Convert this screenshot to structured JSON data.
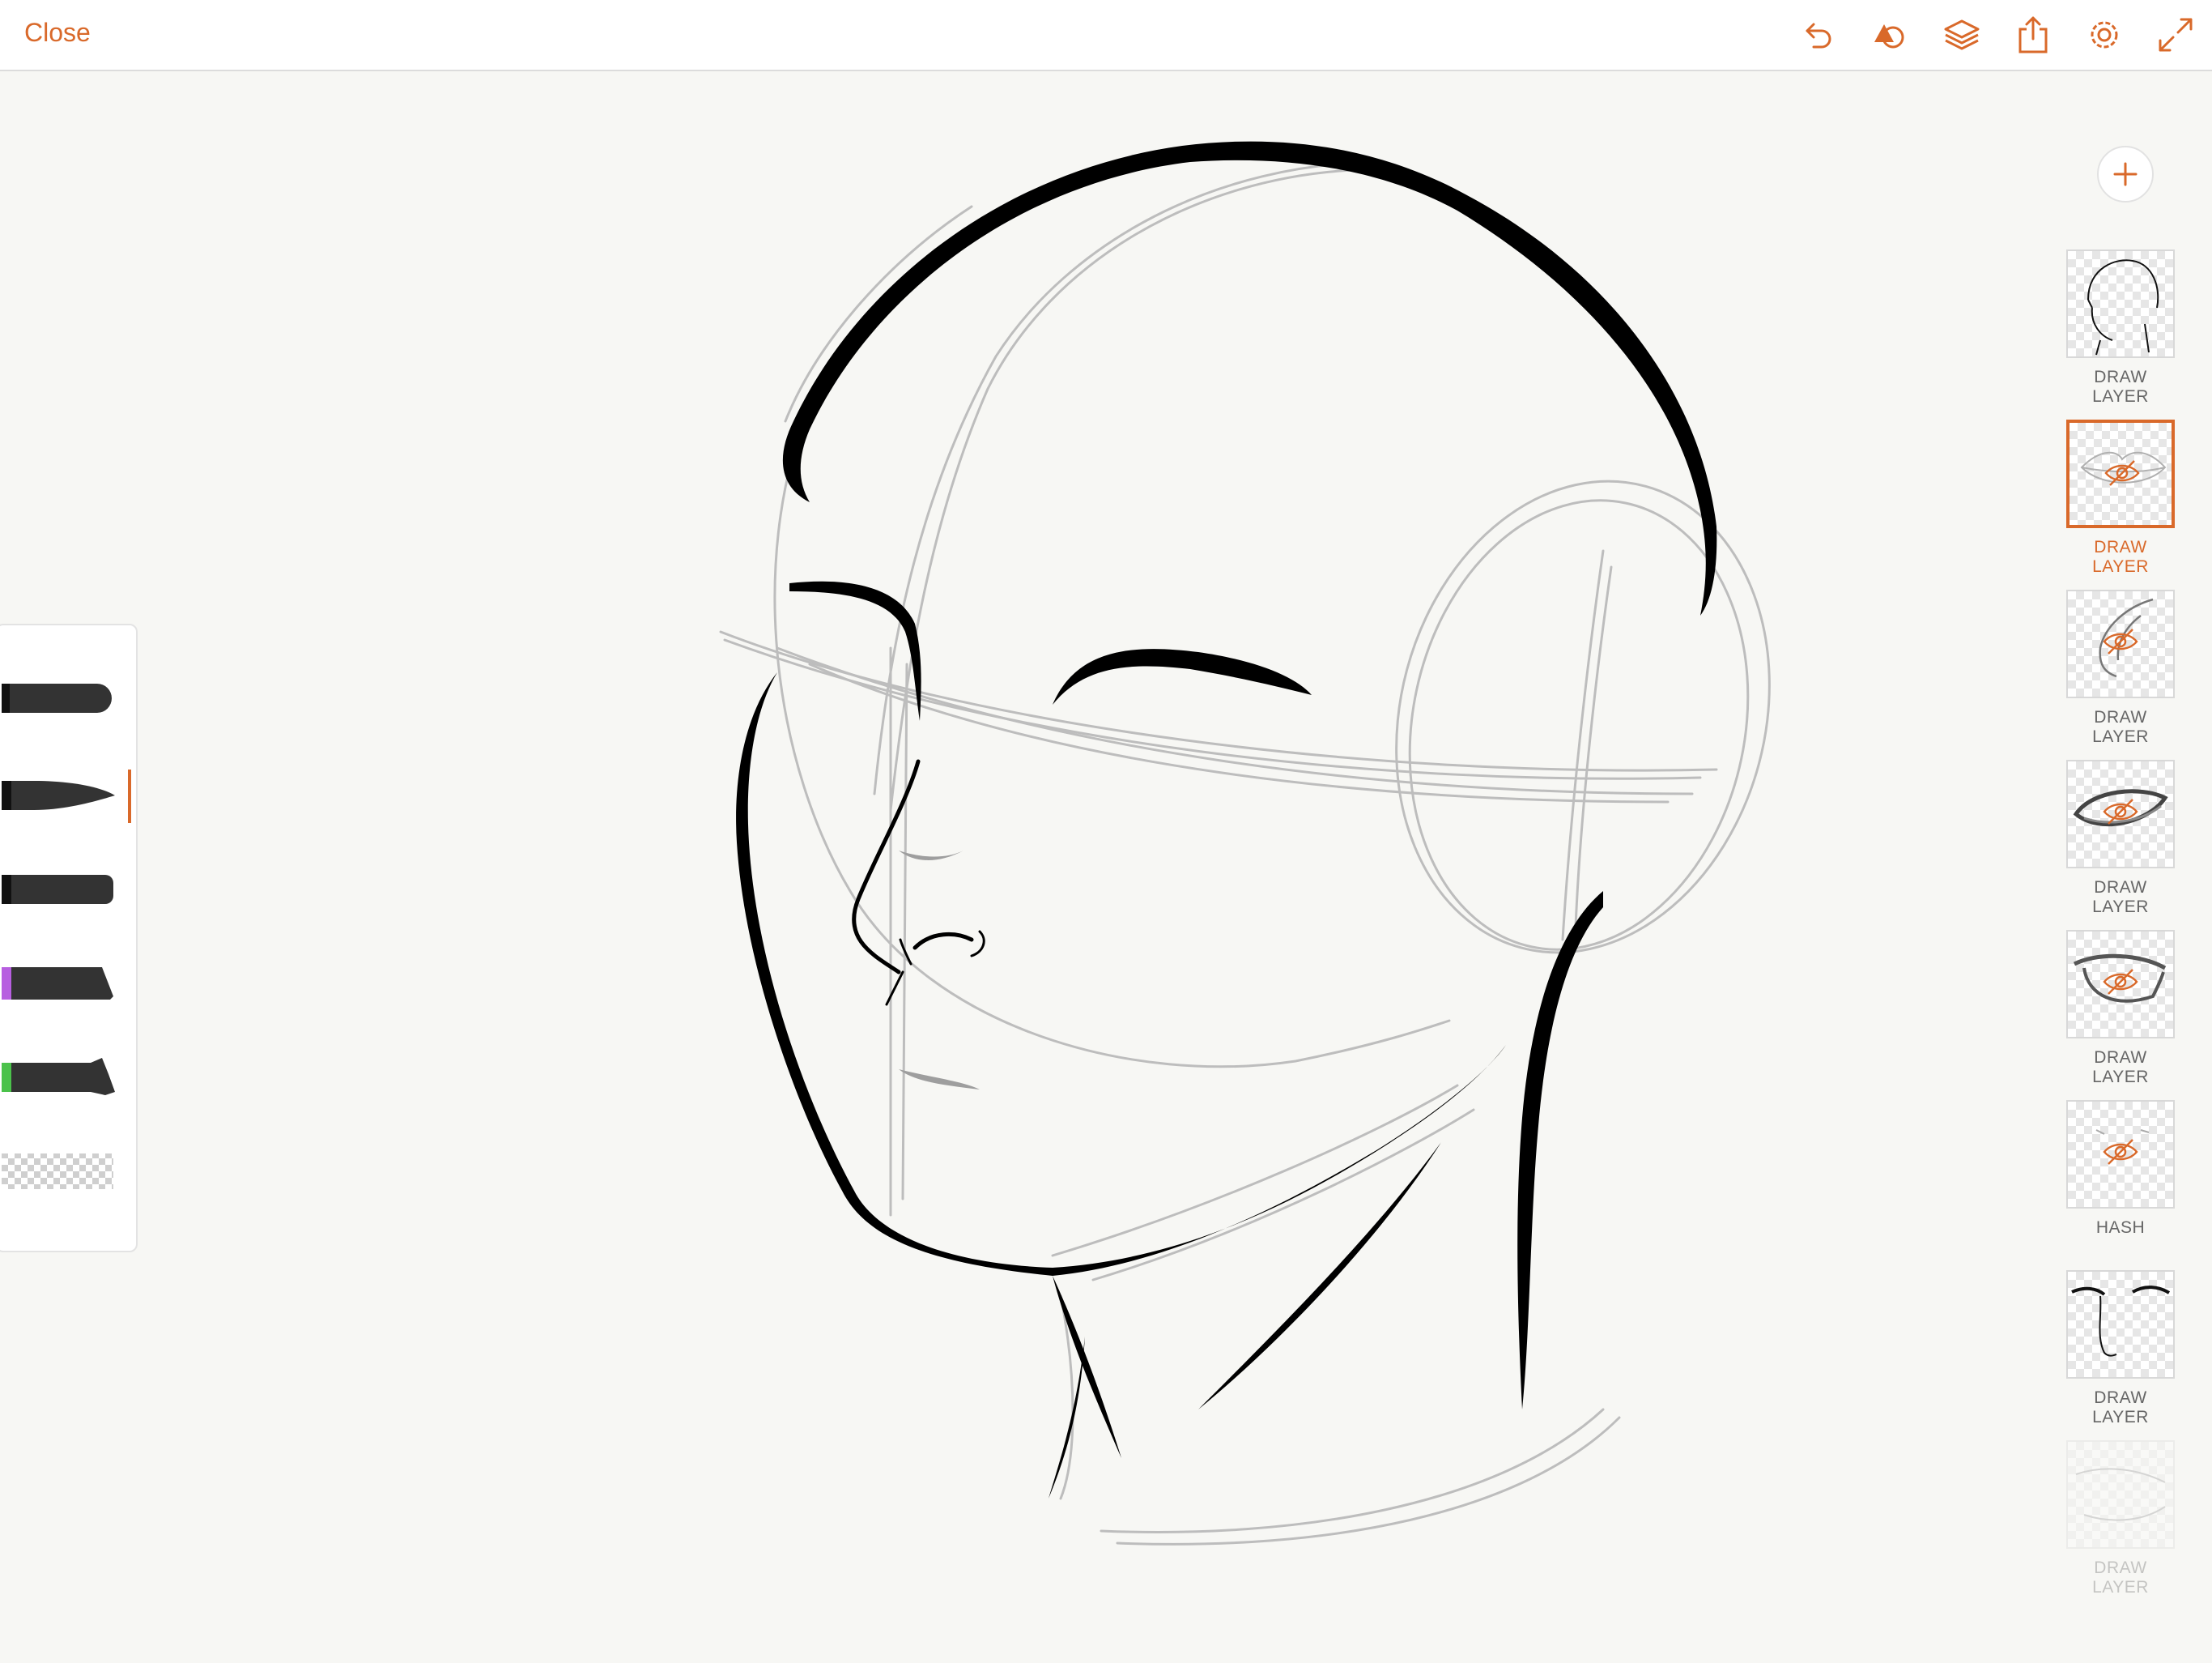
{
  "app": {
    "close_label": "Close",
    "accent_color": "#d9692a"
  },
  "toolbar": {
    "icons": [
      "undo-icon",
      "shapes-icon",
      "layers-icon",
      "share-icon",
      "settings-icon",
      "fullscreen-icon"
    ]
  },
  "brushes": [
    {
      "name": "pen-brush",
      "color": "#333333",
      "accent": null,
      "selected": false
    },
    {
      "name": "tapered-brush",
      "color": "#333333",
      "accent": null,
      "selected": true
    },
    {
      "name": "ink-brush",
      "color": "#333333",
      "accent": null,
      "selected": false
    },
    {
      "name": "marker-brush",
      "color": "#333333",
      "accent": "#b75ee0",
      "selected": false
    },
    {
      "name": "wet-brush",
      "color": "#333333",
      "accent": "#4bc24b",
      "selected": false
    },
    {
      "name": "eraser-brush",
      "color": "checker",
      "accent": null,
      "selected": false
    }
  ],
  "layers": {
    "add_icon": "plus-icon",
    "items": [
      {
        "label": "DRAW LAYER",
        "selected": false,
        "hidden": false,
        "thumb": "head-outline"
      },
      {
        "label": "DRAW LAYER",
        "selected": true,
        "hidden": true,
        "thumb": "lips"
      },
      {
        "label": "DRAW LAYER",
        "selected": false,
        "hidden": true,
        "thumb": "ear"
      },
      {
        "label": "DRAW LAYER",
        "selected": false,
        "hidden": true,
        "thumb": "eye"
      },
      {
        "label": "DRAW LAYER",
        "selected": false,
        "hidden": true,
        "thumb": "eye-2"
      },
      {
        "label": "HASH",
        "selected": false,
        "hidden": true,
        "thumb": "hash"
      },
      {
        "label": "DRAW LAYER",
        "selected": false,
        "hidden": false,
        "thumb": "face-features"
      },
      {
        "label": "DRAW LAYER",
        "selected": false,
        "hidden": false,
        "thumb": "sketch"
      }
    ]
  }
}
